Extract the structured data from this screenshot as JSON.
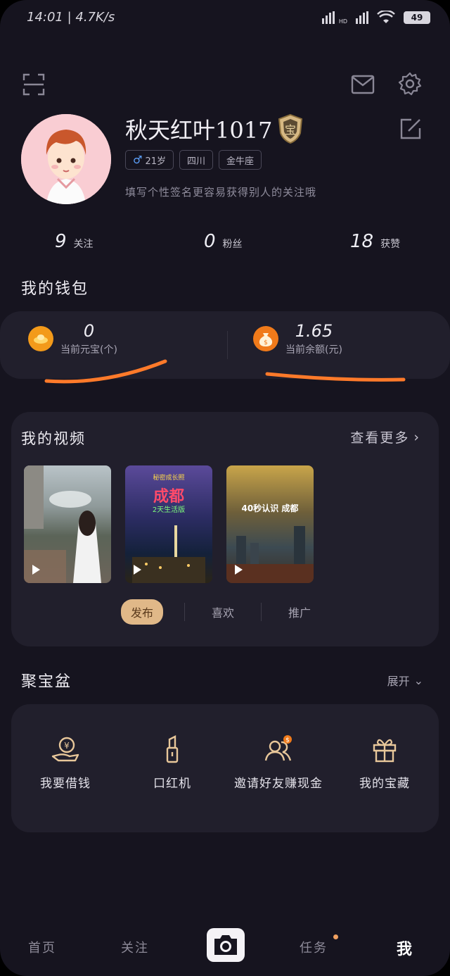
{
  "status_bar": {
    "time": "14:01 | 4.7K/s",
    "battery": "49",
    "network": "HD"
  },
  "profile": {
    "username": "秋天红叶1017",
    "badge_char": "宝",
    "tags": [
      {
        "icon": "♂",
        "label": "21岁"
      },
      {
        "label": "四川"
      },
      {
        "label": "金牛座"
      }
    ],
    "bio": "填写个性签名更容易获得别人的关注哦"
  },
  "stats": [
    {
      "value": "9",
      "label": "关注"
    },
    {
      "value": "0",
      "label": "粉丝"
    },
    {
      "value": "18",
      "label": "获赞"
    }
  ],
  "wallet": {
    "title": "我的钱包",
    "yuanbao": {
      "value": "0",
      "label": "当前元宝(个)"
    },
    "balance": {
      "value": "1.65",
      "label": "当前余额(元)"
    },
    "underline_color": "#ff7a2a"
  },
  "videos": {
    "title": "我的视频",
    "more_label": "查看更多",
    "thumbs": [
      {
        "caption": ""
      },
      {
        "caption_top": "秘密成长照",
        "caption_main": "成都",
        "caption_sub": "2天生活版"
      },
      {
        "caption": "40秒认识 成都"
      }
    ],
    "tabs": [
      "发布",
      "喜欢",
      "推广"
    ]
  },
  "treasure": {
    "title": "聚宝盆",
    "expand_label": "展开",
    "items": [
      {
        "icon": "borrow-money-icon",
        "label": "我要借钱"
      },
      {
        "icon": "lipstick-icon",
        "label": "口红机"
      },
      {
        "icon": "invite-friends-icon",
        "label": "邀请好友赚现金"
      },
      {
        "icon": "gift-icon",
        "label": "我的宝藏"
      }
    ]
  },
  "nav": {
    "items": [
      "首页",
      "关注",
      "任务",
      "我"
    ],
    "active": "我"
  },
  "colors": {
    "background": "#16141f",
    "card": "#211f2c",
    "accent": "#e0b888",
    "orange": "#f08a1a"
  }
}
